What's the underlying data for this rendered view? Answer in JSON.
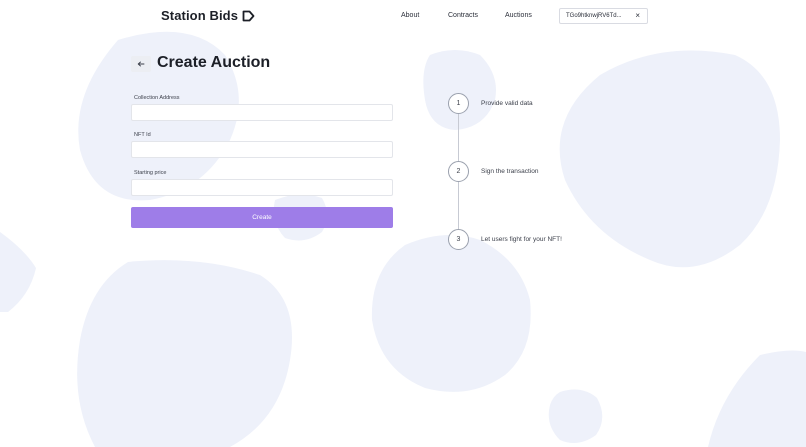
{
  "header": {
    "logo_text": "Station Bids",
    "nav": [
      {
        "label": "About"
      },
      {
        "label": "Contracts"
      },
      {
        "label": "Auctions"
      }
    ],
    "wallet_address": "TGo9htknwjRV6Td...",
    "wallet_close": "×"
  },
  "page": {
    "title": "Create Auction",
    "back_icon": "arrow-left-icon"
  },
  "form": {
    "fields": [
      {
        "label": "Collection Address",
        "value": ""
      },
      {
        "label": "NFT Id",
        "value": ""
      },
      {
        "label": "Starting price",
        "value": ""
      }
    ],
    "submit_label": "Create"
  },
  "steps": [
    {
      "number": "1",
      "text": "Provide valid data"
    },
    {
      "number": "2",
      "text": "Sign the transaction"
    },
    {
      "number": "3",
      "text": "Let users fight for your NFT!"
    }
  ],
  "colors": {
    "accent": "#9e7de8",
    "blob": "#eef1fa",
    "text": "#1c1f27"
  }
}
